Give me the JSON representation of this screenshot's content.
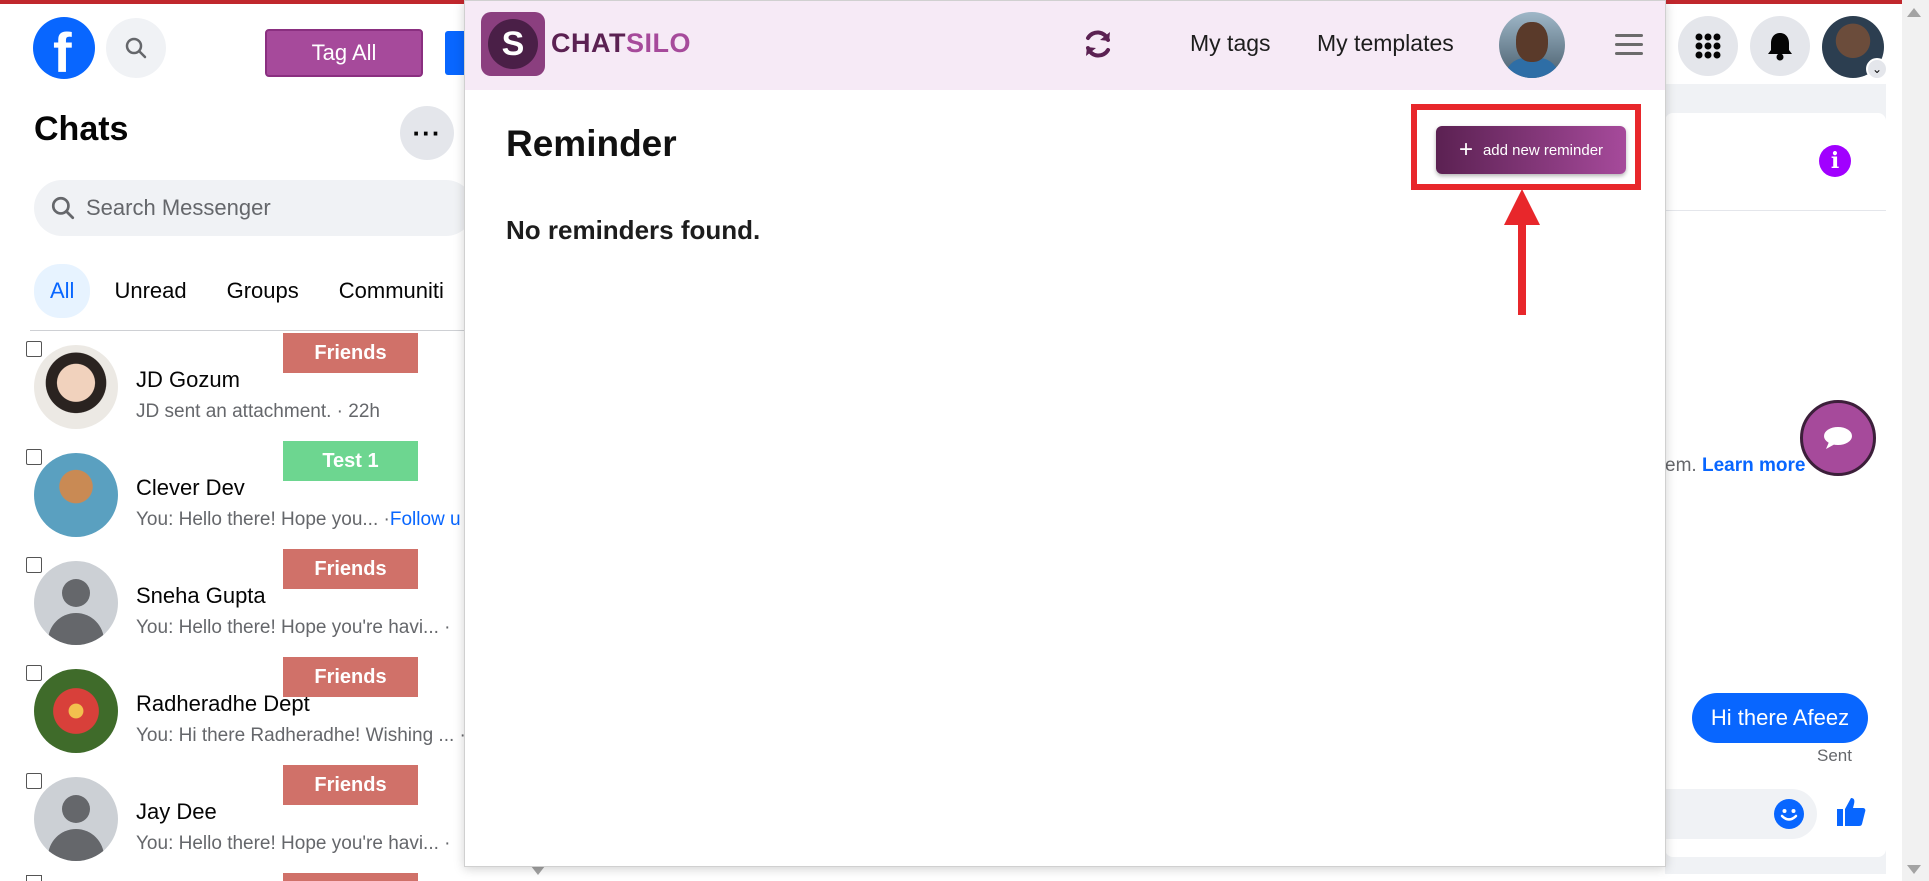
{
  "facebook": {
    "logo_letter": "f",
    "tag_all_label": "Tag All"
  },
  "chats": {
    "title": "Chats",
    "more_label": "···",
    "search_placeholder": "Search Messenger",
    "filters": [
      "All",
      "Unread",
      "Groups",
      "Communiti"
    ],
    "items": [
      {
        "name": "JD Gozum",
        "message": "JD sent an attachment. · 22h",
        "tag": "Friends",
        "tag_color": "#d07169"
      },
      {
        "name": "Clever Dev",
        "message": "You: Hello there! Hope you... ·",
        "extra": "Follow u",
        "tag": "Test 1",
        "tag_color": "#6dd690"
      },
      {
        "name": "Sneha Gupta",
        "message": "You: Hello there! Hope you're havi... ·",
        "tag": "Friends",
        "tag_color": "#d07169"
      },
      {
        "name": "Radheradhe Dept",
        "message": "You: Hi there Radheradhe! Wishing ... ·",
        "tag": "Friends",
        "tag_color": "#d07169"
      },
      {
        "name": "Jay Dee",
        "message": "You: Hello there! Hope you're havi... ·",
        "tag": "Friends",
        "tag_color": "#d07169"
      }
    ]
  },
  "conversation": {
    "learn_prefix": "em.",
    "learn_more": "Learn more",
    "sent_message": "Hi there Afeez",
    "sent_status": "Sent"
  },
  "chatsilo": {
    "brand_part1": "CHAT",
    "brand_part2": "SILO",
    "logo_letter": "S",
    "nav_my_tags": "My tags",
    "nav_my_templates": "My templates",
    "page_title": "Reminder",
    "add_button_label": "add new reminder",
    "empty_message": "No reminders found.",
    "brand_color": "#a64a9b"
  },
  "annotation": {
    "highlight_color": "#e8272b"
  }
}
